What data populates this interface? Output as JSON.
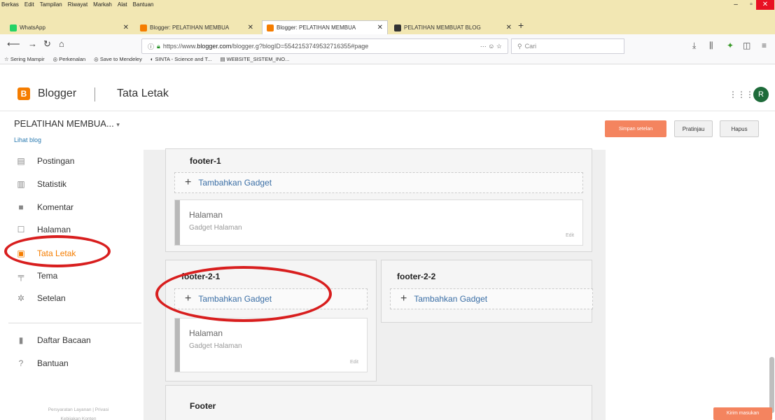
{
  "browser": {
    "menu": [
      "Berkas",
      "Edit",
      "Tampilan",
      "Riwayat",
      "Markah",
      "Alat",
      "Bantuan"
    ],
    "tabs": [
      {
        "label": "WhatsApp"
      },
      {
        "label": "Blogger: PELATIHAN MEMBUA"
      },
      {
        "label": "Blogger: PELATIHAN MEMBUA"
      },
      {
        "label": "PELATIHAN MEMBUAT BLOG"
      }
    ],
    "url_prefix": "https://www.",
    "url_domain": "blogger.com",
    "url_suffix": "/blogger.g?blogID=5542153749532716355#page",
    "url_tools": "··· ☺ ☆",
    "search_placeholder": "Cari",
    "bookmarks": [
      "Sering Mampir",
      "Perkenalan",
      "Save to Mendeley",
      "SINTA - Science and T...",
      "WEBSITE_SISTEM_INO..."
    ]
  },
  "app": {
    "logo_letter": "B",
    "logo_text": "Blogger",
    "page_title": "Tata Letak",
    "avatar_letter": "R",
    "blog_name": "PELATIHAN MEMBUA...",
    "view_blog": "Lihat blog",
    "save_label": "Simpan setelan",
    "preview_label": "Pratinjau",
    "delete_label": "Hapus"
  },
  "sidebar": {
    "items": [
      {
        "label": "Postingan",
        "icon": "posts-icon"
      },
      {
        "label": "Statistik",
        "icon": "stats-icon"
      },
      {
        "label": "Komentar",
        "icon": "comments-icon"
      },
      {
        "label": "Halaman",
        "icon": "pages-icon"
      },
      {
        "label": "Tata Letak",
        "icon": "layout-icon",
        "active": true
      },
      {
        "label": "Tema",
        "icon": "theme-icon"
      },
      {
        "label": "Setelan",
        "icon": "settings-icon"
      }
    ],
    "secondary": [
      {
        "label": "Daftar Bacaan",
        "icon": "bookmark-icon"
      },
      {
        "label": "Bantuan",
        "icon": "help-icon"
      }
    ],
    "footer_line1": "Persyaratan Layanan  |  Privasi",
    "footer_line2": "Kebijakan Konten"
  },
  "layout": {
    "footer1_title": "footer-1",
    "add_gadget": "Tambahkan Gadget",
    "gadget_title": "Halaman",
    "gadget_sub": "Gadget Halaman",
    "gadget_edit": "Edit",
    "footer21_title": "footer-2-1",
    "footer22_title": "footer-2-2",
    "footer_title": "Footer"
  },
  "feedback_label": "Kirim masukan",
  "colors": {
    "accent": "#f57d00",
    "link": "#3a6ea5",
    "annotation_ring": "#d81e1e"
  }
}
